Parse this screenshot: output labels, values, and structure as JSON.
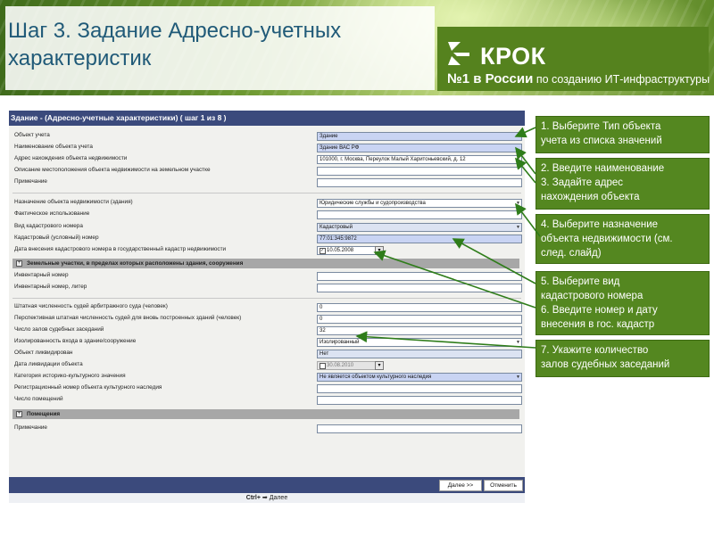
{
  "header": {
    "title": "Шаг 3. Задание Адресно-учетных характеристик",
    "logo_text": "КРОК",
    "tagline_bold": "№1 в России",
    "tagline_rest": " по созданию ИТ-инфраструктуры"
  },
  "form": {
    "title": "Здание - (Адресно-учетные характеристики) ( шаг 1 из 8 )",
    "fields": {
      "object_type": {
        "label": "Объект учета",
        "value": "Здание"
      },
      "object_name": {
        "label": "Наименование объекта учета",
        "value": "Здание ВАС РФ"
      },
      "address": {
        "label": "Адрес нахождения объекта недвижимости",
        "value": "101000, г. Москва, Переулок Малый Харитоньевский, д. 12"
      },
      "location_desc": {
        "label": "Описание местоположения объекта недвижимости на земельном участке",
        "value": ""
      },
      "note1": {
        "label": "Примечание",
        "value": ""
      },
      "purpose": {
        "label": "Назначение объекта недвижимости (здания)",
        "value": "Юридические службы и судопроизводства"
      },
      "actual_use": {
        "label": "Фактическое использование",
        "value": ""
      },
      "cadastral_type": {
        "label": "Вид кадастрового номера",
        "value": "Кадастровый"
      },
      "cadastral_number": {
        "label": "Кадастровый (условный) номер",
        "value": "77:01:345:9872"
      },
      "cadastral_date": {
        "label": "Дата внесения кадастрового номера в государственный кадастр недвижимости",
        "value": "10.05.2008",
        "checked": "✓"
      },
      "inventory_number": {
        "label": "Инвентарный номер",
        "value": ""
      },
      "inventory_letter": {
        "label": "Инвентарный номер, литер",
        "value": ""
      },
      "staff_arbitration": {
        "label": "Штатная численность судей арбитражного суда (человек)",
        "value": "0"
      },
      "staff_new": {
        "label": "Перспективная штатная численность судей для вновь построенных зданий (человек)",
        "value": "0"
      },
      "court_halls": {
        "label": "Число залов судебных заседаний",
        "value": "32"
      },
      "entrance": {
        "label": "Изолированность входа в здание/сооружение",
        "value": "Изолированный"
      },
      "liquidated": {
        "label": "Объект ликвидирован",
        "value": "Нет"
      },
      "liquidation_date": {
        "label": "Дата ликвидации объекта",
        "value": "30.08.2010"
      },
      "heritage_category": {
        "label": "Категория историко-культурного значения",
        "value": "Не является объектом культурного наследия"
      },
      "heritage_reg": {
        "label": "Регистрационный номер объекта культурного наследия",
        "value": ""
      },
      "rooms_count": {
        "label": "Число помещений",
        "value": ""
      },
      "note2": {
        "label": "Примечание",
        "value": ""
      }
    },
    "groups": {
      "land": "Земельные участки, в пределах которых расположены здания, сооружения",
      "rooms": "Помещения"
    },
    "buttons": {
      "next": "Далее >>",
      "cancel": "Отменить"
    },
    "status": {
      "shortcut": "Ctrl+",
      "arrow": "➡",
      "text": "Далее"
    }
  },
  "callouts": [
    {
      "lines": [
        "1. Выберите Тип объекта",
        "учета из списка значений"
      ]
    },
    {
      "lines": [
        "2. Введите наименование",
        "3. Задайте адрес",
        "нахождения объекта"
      ]
    },
    {
      "lines": [
        "4. Выберите назначение",
        "объекта недвижимости (см.",
        "след. слайд)"
      ]
    },
    {
      "lines": [
        "5. Выберите вид",
        "кадастрового номера",
        "6. Введите номер и дату",
        "внесения в гос. кадастр"
      ]
    },
    {
      "lines": [
        "7.  Укажите количество",
        "залов судебных заседаний"
      ]
    }
  ],
  "colors": {
    "form_header": "#3b4a7c",
    "required_field": "#c9d4f3",
    "callout_bg": "#548720",
    "title_text": "#205a78"
  },
  "icons": [
    "dropdown-arrow-icon",
    "expand-plus-icon",
    "checkbox-icon",
    "calendar-icon",
    "logo-mark-icon"
  ]
}
